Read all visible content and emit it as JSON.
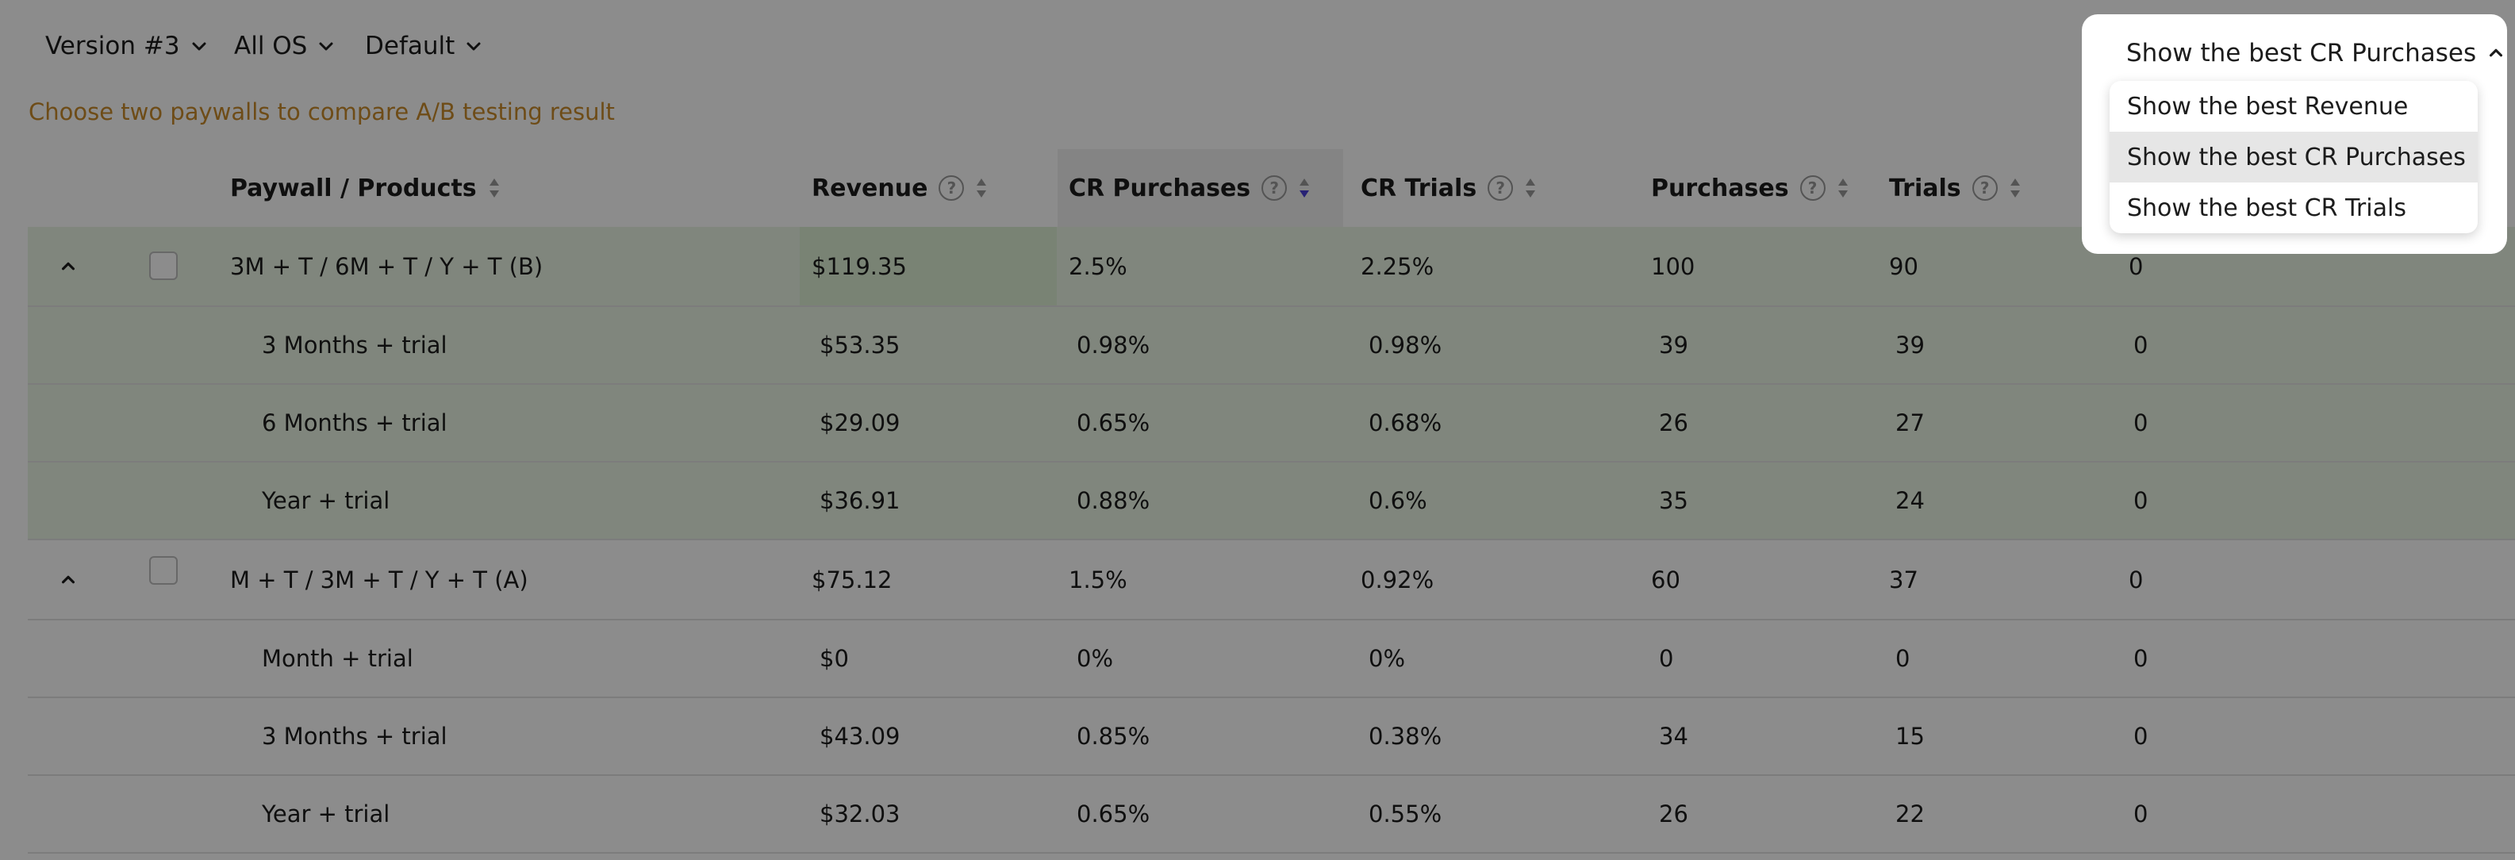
{
  "filters": {
    "version": "Version #3",
    "os": "All OS",
    "segment": "Default"
  },
  "hint": "Choose two paywalls to compare A/B testing result",
  "columns": {
    "paywall": "Paywall / Products",
    "revenue": "Revenue",
    "cr_purchases": "CR Purchases",
    "cr_trials": "CR Trials",
    "purchases": "Purchases",
    "trials": "Trials",
    "help_glyph": "?"
  },
  "rows": [
    {
      "name": "3M + T / 6M + T / Y + T (B)",
      "revenue": "$119.35",
      "cr_purchases": "2.5%",
      "cr_trials": "2.25%",
      "purchases": "100",
      "trials": "90",
      "extra": "0"
    },
    {
      "name": "3 Months + trial",
      "revenue": "$53.35",
      "cr_purchases": "0.98%",
      "cr_trials": "0.98%",
      "purchases": "39",
      "trials": "39",
      "extra": "0"
    },
    {
      "name": "6 Months + trial",
      "revenue": "$29.09",
      "cr_purchases": "0.65%",
      "cr_trials": "0.68%",
      "purchases": "26",
      "trials": "27",
      "extra": "0"
    },
    {
      "name": "Year + trial",
      "revenue": "$36.91",
      "cr_purchases": "0.88%",
      "cr_trials": "0.6%",
      "purchases": "35",
      "trials": "24",
      "extra": "0"
    },
    {
      "name": "M + T / 3M + T / Y + T (A)",
      "revenue": "$75.12",
      "cr_purchases": "1.5%",
      "cr_trials": "0.92%",
      "purchases": "60",
      "trials": "37",
      "extra": "0"
    },
    {
      "name": "Month + trial",
      "revenue": "$0",
      "cr_purchases": "0%",
      "cr_trials": "0%",
      "purchases": "0",
      "trials": "0",
      "extra": "0"
    },
    {
      "name": "3 Months + trial",
      "revenue": "$43.09",
      "cr_purchases": "0.85%",
      "cr_trials": "0.38%",
      "purchases": "34",
      "trials": "15",
      "extra": "0"
    },
    {
      "name": "Year + trial",
      "revenue": "$32.03",
      "cr_purchases": "0.65%",
      "cr_trials": "0.55%",
      "purchases": "26",
      "trials": "22",
      "extra": "0"
    }
  ],
  "dropdown": {
    "selected": "Show the best CR Purchases",
    "options": [
      "Show the best Revenue",
      "Show the best CR Purchases",
      "Show the best CR Trials"
    ],
    "selected_index": 1
  },
  "colors": {
    "hint": "#c98a2b",
    "winner_row": "#e9f5e4",
    "winner_cell": "#dcefd4",
    "sort_active": "#4a3fd6",
    "overlay": "rgba(0,0,0,0.45)"
  },
  "icons": [
    "chevron-down-icon",
    "chevron-up-icon",
    "help-icon",
    "sort-icon",
    "checkbox-icon"
  ]
}
